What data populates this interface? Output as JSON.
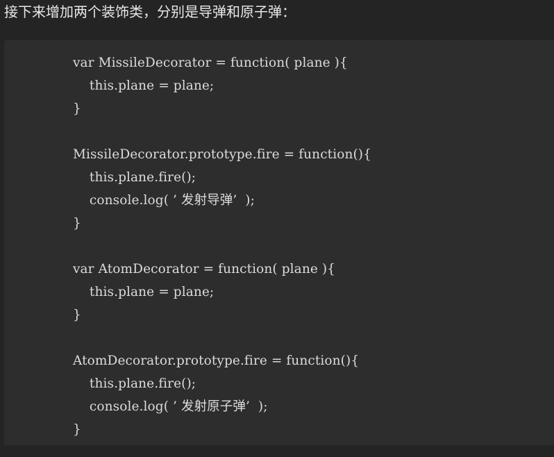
{
  "intro": {
    "text": "接下来增加两个装饰类，分别是导弹和原子弹："
  },
  "code": {
    "lines": [
      "var MissileDecorator = function( plane ){",
      "    this.plane = plane;",
      "}",
      "",
      "MissileDecorator.prototype.fire = function(){",
      "    this.plane.fire();",
      "    console.log( ’ 发射导弹’  );",
      "}",
      "",
      "var AtomDecorator = function( plane ){",
      "    this.plane = plane;",
      "}",
      "",
      "AtomDecorator.prototype.fire = function(){",
      "    this.plane.fire();",
      "    console.log( ’ 发射原子弹’  );",
      "}"
    ]
  }
}
